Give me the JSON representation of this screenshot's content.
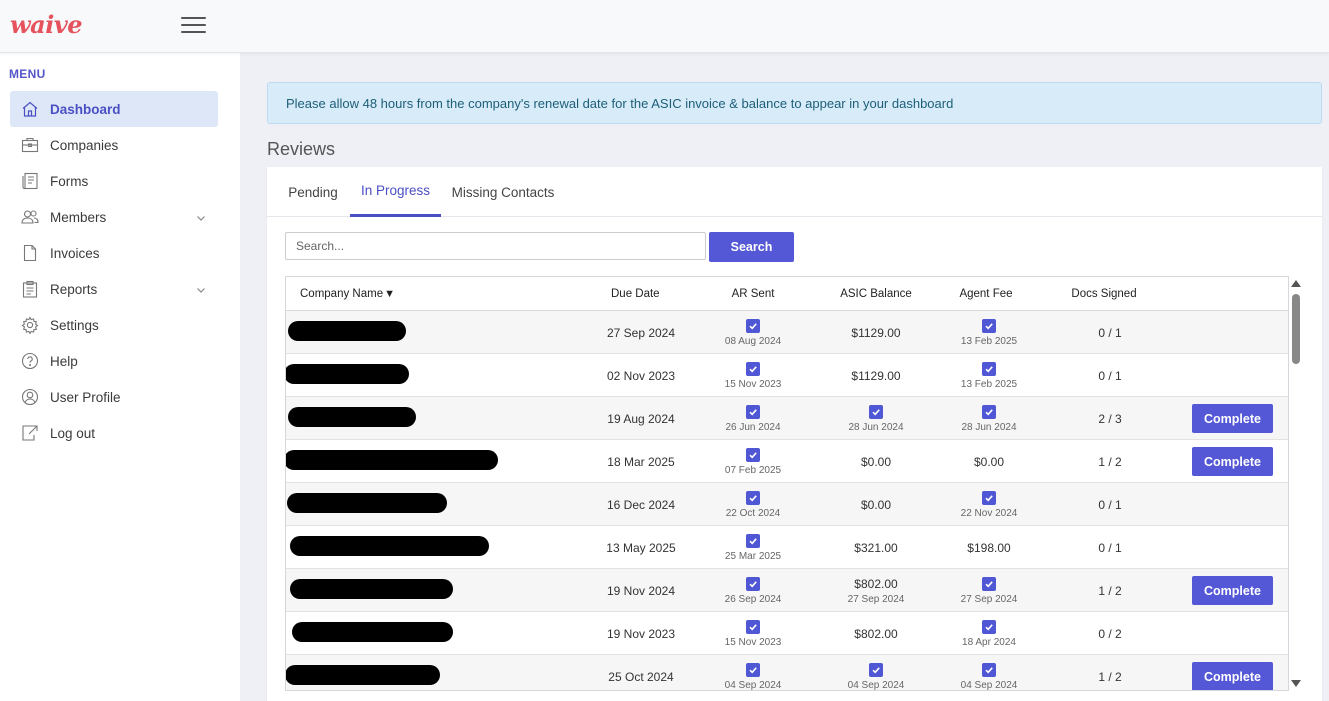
{
  "brand": {
    "logo_text": "waive"
  },
  "sidebar": {
    "menu_title": "MENU",
    "items": [
      {
        "label": "Dashboard",
        "icon": "home-icon",
        "active": true
      },
      {
        "label": "Companies",
        "icon": "briefcase-icon"
      },
      {
        "label": "Forms",
        "icon": "forms-icon"
      },
      {
        "label": "Members",
        "icon": "users-icon",
        "has_dropdown": true
      },
      {
        "label": "Invoices",
        "icon": "document-icon"
      },
      {
        "label": "Reports",
        "icon": "clipboard-icon",
        "has_dropdown": true
      },
      {
        "label": "Settings",
        "icon": "gear-icon"
      },
      {
        "label": "Help",
        "icon": "help-icon"
      },
      {
        "label": "User Profile",
        "icon": "user-icon"
      },
      {
        "label": "Log out",
        "icon": "logout-icon"
      }
    ]
  },
  "alert": {
    "text": "Please allow 48 hours from the company's renewal date for the ASIC invoice & balance to appear in your dashboard"
  },
  "reviews": {
    "title": "Reviews",
    "tabs": [
      {
        "label": "Pending"
      },
      {
        "label": "In Progress",
        "active": true
      },
      {
        "label": "Missing Contacts"
      }
    ],
    "search": {
      "placeholder": "Search...",
      "button_label": "Search"
    },
    "table": {
      "columns": [
        "Company Name",
        "Due Date",
        "AR Sent",
        "ASIC Balance",
        "Agent Fee",
        "Docs Signed"
      ],
      "sort_indicator": "▼",
      "complete_label": "Complete",
      "rows": [
        {
          "due_date": "27 Sep 2024",
          "ar_sent": {
            "checked": true,
            "date": "08 Aug 2024"
          },
          "asic_balance": {
            "value": "$1129.00"
          },
          "agent_fee": {
            "checked": true,
            "date": "13 Feb 2025"
          },
          "docs_signed": "0 / 1",
          "complete": false
        },
        {
          "due_date": "02 Nov 2023",
          "ar_sent": {
            "checked": true,
            "date": "15 Nov 2023"
          },
          "asic_balance": {
            "value": "$1129.00"
          },
          "agent_fee": {
            "checked": true,
            "date": "13 Feb 2025"
          },
          "docs_signed": "0 / 1",
          "complete": false
        },
        {
          "due_date": "19 Aug 2024",
          "ar_sent": {
            "checked": true,
            "date": "26 Jun 2024"
          },
          "asic_balance": {
            "checked": true,
            "date": "28 Jun 2024"
          },
          "agent_fee": {
            "checked": true,
            "date": "28 Jun 2024"
          },
          "docs_signed": "2 / 3",
          "complete": true
        },
        {
          "due_date": "18 Mar 2025",
          "ar_sent": {
            "checked": true,
            "date": "07 Feb 2025"
          },
          "asic_balance": {
            "value": "$0.00"
          },
          "agent_fee": {
            "value": "$0.00"
          },
          "docs_signed": "1 / 2",
          "complete": true
        },
        {
          "due_date": "16 Dec 2024",
          "ar_sent": {
            "checked": true,
            "date": "22 Oct 2024"
          },
          "asic_balance": {
            "value": "$0.00"
          },
          "agent_fee": {
            "checked": true,
            "date": "22 Nov 2024"
          },
          "docs_signed": "0 / 1",
          "complete": false
        },
        {
          "due_date": "13 May 2025",
          "ar_sent": {
            "checked": true,
            "date": "25 Mar 2025"
          },
          "asic_balance": {
            "value": "$321.00"
          },
          "agent_fee": {
            "value": "$198.00"
          },
          "docs_signed": "0 / 1",
          "complete": false
        },
        {
          "due_date": "19 Nov 2024",
          "ar_sent": {
            "checked": true,
            "date": "26 Sep 2024"
          },
          "asic_balance": {
            "value": "$802.00",
            "date": "27 Sep 2024"
          },
          "agent_fee": {
            "checked": true,
            "date": "27 Sep 2024"
          },
          "docs_signed": "1 / 2",
          "complete": true
        },
        {
          "due_date": "19 Nov 2023",
          "ar_sent": {
            "checked": true,
            "date": "15 Nov 2023"
          },
          "asic_balance": {
            "value": "$802.00"
          },
          "agent_fee": {
            "checked": true,
            "date": "18 Apr 2024"
          },
          "docs_signed": "0 / 2",
          "complete": false
        },
        {
          "due_date": "25 Oct 2024",
          "ar_sent": {
            "checked": true,
            "date": "04 Sep 2024"
          },
          "asic_balance": {
            "checked": true,
            "date": "04 Sep 2024"
          },
          "agent_fee": {
            "checked": true,
            "date": "04 Sep 2024"
          },
          "docs_signed": "1 / 2",
          "complete": true
        }
      ]
    }
  },
  "colors": {
    "accent": "#5457d6",
    "brand": "#e5535d",
    "alert_bg": "#d7ebf9"
  }
}
